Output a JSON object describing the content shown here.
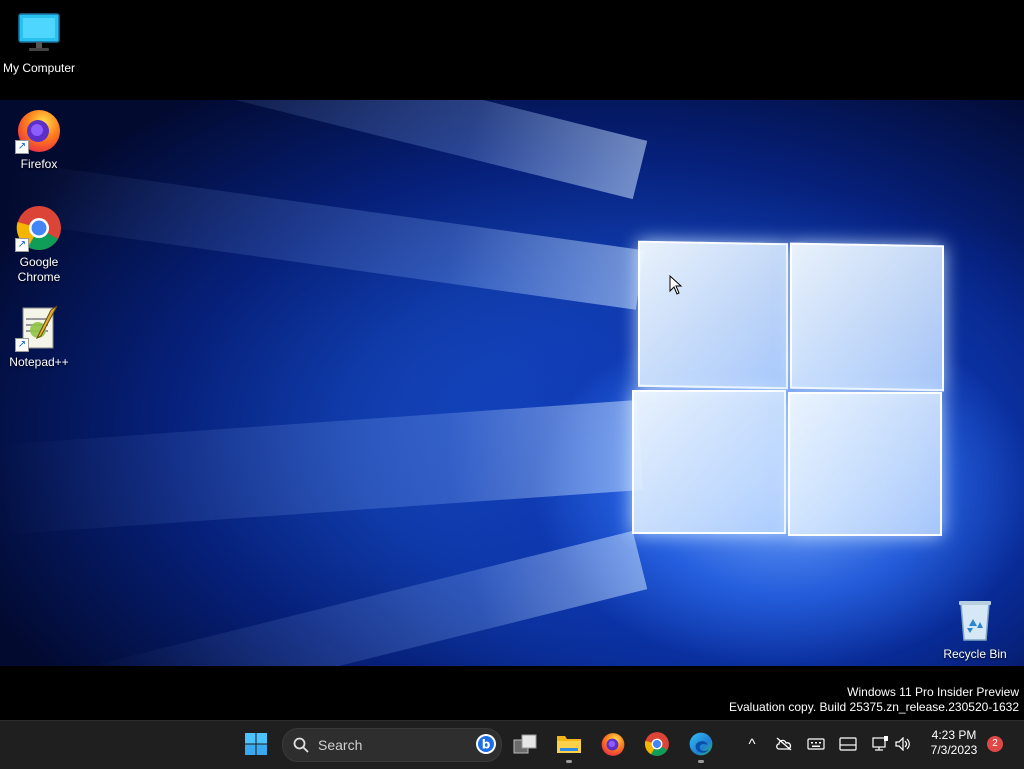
{
  "desktop": {
    "icons": [
      {
        "label": "My Computer",
        "icon": "computer-monitor-icon"
      },
      {
        "label": "Firefox",
        "icon": "firefox-icon"
      },
      {
        "label": "Google Chrome",
        "icon": "chrome-icon"
      },
      {
        "label": "Notepad++",
        "icon": "notepad-plus-plus-icon"
      },
      {
        "label": "Recycle Bin",
        "icon": "recycle-bin-icon"
      }
    ],
    "shortcut_glyph": "↗",
    "watermark": {
      "line1": "Windows 11 Pro Insider Preview",
      "line2": "Evaluation copy. Build 25375.zn_release.230520-1632"
    }
  },
  "taskbar": {
    "search_placeholder": "Search",
    "apps": [
      {
        "icon": "start-windows-icon"
      },
      {
        "icon": "search-icon"
      },
      {
        "icon": "bing-icon"
      },
      {
        "icon": "task-view-icon"
      },
      {
        "icon": "file-explorer-icon",
        "running": true
      },
      {
        "icon": "firefox-icon"
      },
      {
        "icon": "chrome-icon"
      },
      {
        "icon": "edge-icon",
        "running": true
      }
    ],
    "tray": {
      "overflow_glyph": "^",
      "time": "4:23 PM",
      "date": "7/3/2023",
      "notification_count": "2"
    }
  },
  "colors": {
    "taskbar_bg": "#1f1f1f",
    "wallpaper_blue": "#1e56d6",
    "windows_accent": "#0078d4",
    "badge_red": "#e04848"
  }
}
